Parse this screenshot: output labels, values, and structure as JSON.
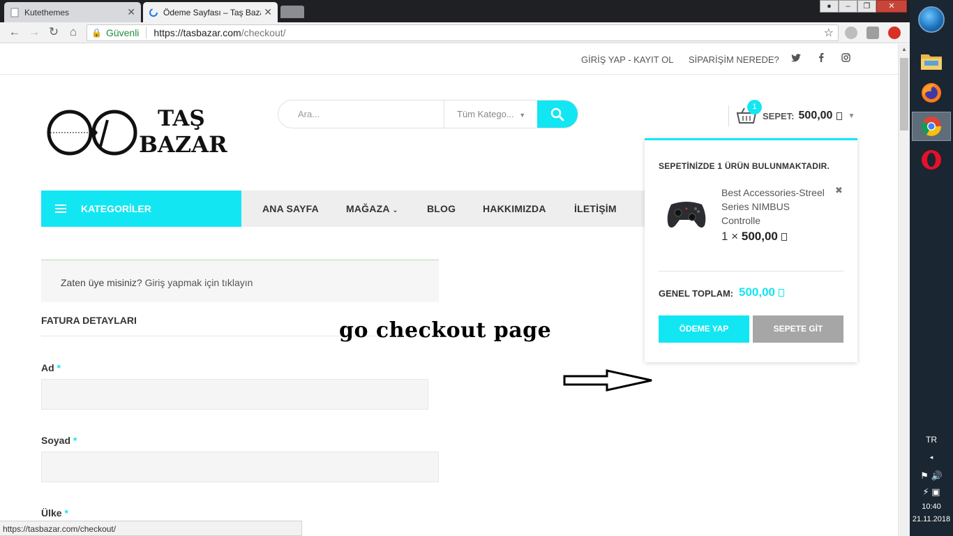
{
  "browser": {
    "tabs": [
      {
        "title": "Kutethemes",
        "active": false
      },
      {
        "title": "Ödeme Sayfası – Taş Bazar",
        "active": true
      }
    ],
    "security_label": "Güvenli",
    "url_host": "https://tasbazar.com",
    "url_path": "/checkout/",
    "status_url": "https://tasbazar.com/checkout/"
  },
  "topbar": {
    "login_register": "GİRİŞ YAP - KAYIT OL",
    "where_is_order": "SİPARİŞİM NEREDE?",
    "social_icons": [
      "twitter-icon",
      "facebook-icon",
      "instagram-icon"
    ]
  },
  "logo": {
    "line1": "TAŞ",
    "line2": "BAZAR"
  },
  "search": {
    "placeholder": "Ara...",
    "category": "Tüm Katego..."
  },
  "cart": {
    "count": "1",
    "label": "SEPET:",
    "total": "500,00"
  },
  "categories_label": "KATEGORİLER",
  "nav": [
    "ANA SAYFA",
    "MAĞAZA",
    "BLOG",
    "HAKKIMIZDA",
    "İLETİŞİM"
  ],
  "login_notice": {
    "text": "Zaten üye misiniz?",
    "link": "Giriş yapmak için tıklayın"
  },
  "billing": {
    "heading": "FATURA DETAYLARI",
    "fields": [
      {
        "label": "Ad",
        "required": "*"
      },
      {
        "label": "Soyad",
        "required": "*"
      },
      {
        "label": "Ülke",
        "required": "*"
      }
    ]
  },
  "minicart": {
    "heading": "SEPETİNİZDE 1 ÜRÜN BULUNMAKTADIR.",
    "item_name": "Best Accessories-Streel Series NIMBUS Controlle",
    "qty": "1",
    "times": "×",
    "price": "500,00",
    "total_label": "GENEL TOPLAM:",
    "total_value": "500,00",
    "checkout_btn": "ÖDEME YAP",
    "cart_btn": "SEPETE GİT"
  },
  "annotation": "go checkout page",
  "taskbar": {
    "lang": "TR",
    "time": "10:40",
    "date": "21.11.2018"
  },
  "colors": {
    "accent": "#12e6f2",
    "nav_bg": "#eeeeee",
    "grey_button": "#a6a6a6"
  }
}
